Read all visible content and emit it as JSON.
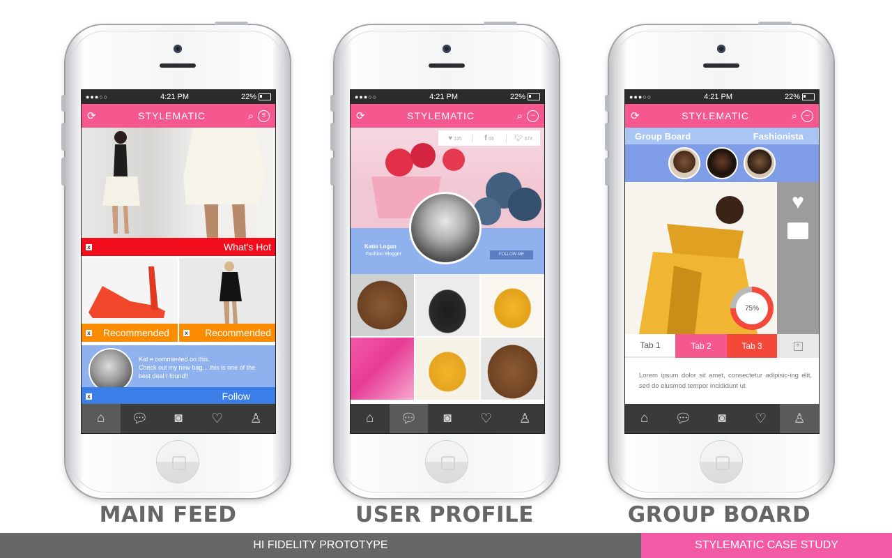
{
  "phones": {
    "main_feed": {
      "status": {
        "signal": "●●●○○",
        "time": "4:21 PM",
        "battery": "22%"
      },
      "app_title": "STYLEMATIC",
      "ribbons": {
        "whats_hot": "What's Hot",
        "recommended_1": "Recommended",
        "recommended_2": "Recommended",
        "follow": "Follow"
      },
      "comment": {
        "line1": "Kat e commented on this.",
        "line2": "Check out my new bag... this is one of the",
        "line3": "best deal I found!!"
      },
      "caption": "MAIN FEED"
    },
    "user_profile": {
      "status": {
        "signal": "●●●○○",
        "time": "4:21 PM",
        "battery": "22%"
      },
      "app_title": "STYLEMATIC",
      "social": {
        "likes": "135",
        "facebook": "69",
        "twitter": "674"
      },
      "profile": {
        "name": "Katie Logan",
        "role": "Fashion Blogger",
        "follow_button": "FOLLOW ME"
      },
      "caption": "USER PROFILE"
    },
    "group_board": {
      "status": {
        "signal": "●●●○○",
        "time": "4:21 PM",
        "battery": "22%"
      },
      "app_title": "STYLEMATIC",
      "header_left": "Group Board",
      "header_right": "Fashionista",
      "progress": "75%",
      "tabs": [
        "Tab 1",
        "Tab 2",
        "Tab 3"
      ],
      "tab_add": "+",
      "body_text": "Lorem ipsum dolor sit amet, consectetur adipisic-ing elit, sed do eiusmod tempor incididunt ut",
      "caption": "GROUP BOARD"
    }
  },
  "footer": {
    "left": "HI FIDELITY PROTOTYPE",
    "right": "STYLEMATIC CASE STUDY"
  },
  "colors": {
    "pink": "#f4588f",
    "red": "#f20d1c",
    "orange": "#fb8c00",
    "blue": "#8fb2ee",
    "dark": "#3a3a3a",
    "footer_grey": "#676767",
    "footer_pink": "#f35aa5"
  }
}
